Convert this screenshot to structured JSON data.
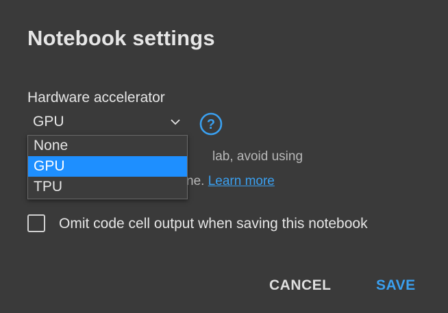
{
  "dialog": {
    "title": "Notebook settings",
    "hardware_label": "Hardware accelerator",
    "selected_value": "GPU",
    "options": [
      {
        "label": "None",
        "selected": false
      },
      {
        "label": "GPU",
        "selected": true
      },
      {
        "label": "TPU",
        "selected": false
      }
    ],
    "info_line1_visible": "lab, avoid using",
    "info_line2_visible": "ne.",
    "learn_more": "Learn more",
    "omit_output_label": "Omit code cell output when saving this notebook",
    "omit_output_checked": false,
    "cancel_label": "CANCEL",
    "save_label": "SAVE"
  },
  "icons": {
    "help": "help-circle-icon",
    "chevron": "chevron-down-icon"
  },
  "colors": {
    "background": "#3a3a3a",
    "accent": "#3aa0f0",
    "selected_option": "#1e8fff"
  }
}
